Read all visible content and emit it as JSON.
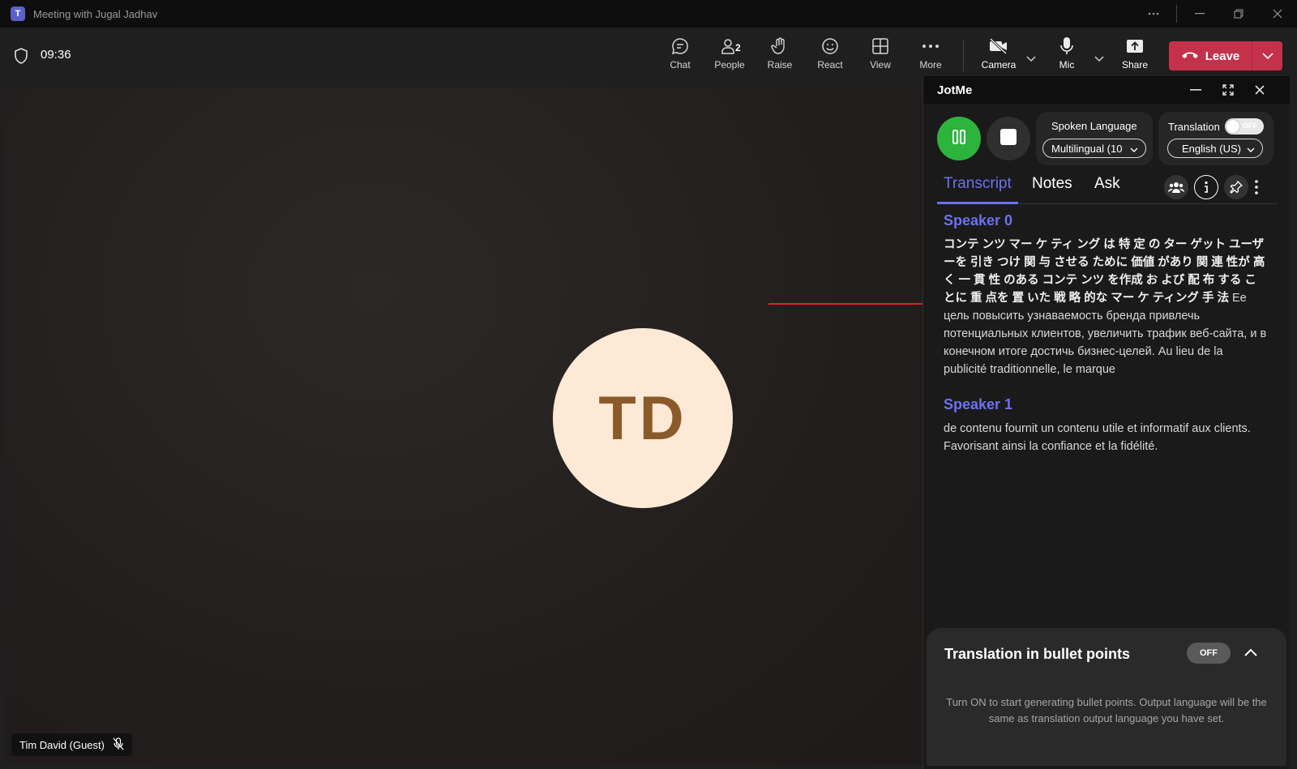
{
  "window": {
    "title": "Meeting with Jugal Jadhav",
    "app_logo": "T"
  },
  "meeting": {
    "elapsed": "09:36",
    "people_count": "2"
  },
  "toolbar": {
    "chat": "Chat",
    "people": "People",
    "raise": "Raise",
    "react": "React",
    "view": "View",
    "more": "More",
    "camera": "Camera",
    "mic": "Mic",
    "share": "Share",
    "leave": "Leave"
  },
  "stage": {
    "avatar_initials": "TD",
    "participant_name": "Tim David (Guest)",
    "avatar_bg": "#fde9d6",
    "avatar_fg": "#8a5a2a"
  },
  "jotme": {
    "title": "JotMe",
    "spoken_language_label": "Spoken Language",
    "spoken_language_value": "Multilingual (10",
    "translation_label": "Translation",
    "translation_toggle": "OFF",
    "translation_language": "English (US)",
    "tabs": [
      "Transcript",
      "Notes",
      "Ask"
    ],
    "transcript": [
      {
        "speaker": "Speaker 0",
        "text_jp": "コンテ ンツ マー ケ ティ ング は 特 定 の ター ゲット ユーザ ーを 引き つけ 関 与 させる ために 価値 があり 関 連 性が 高く 一 貫 性 のある コンテ ンツ を作成 お よび 配 布 する ことに 重 点を 置 いた 戦 略 的な マー ケ ティング 手 法",
        "text_rest": " Ее цель повысить узнаваемость бренда привлечь потенциальных клиентов, увеличить трафик веб-сайта, и в конечном итоге достичь бизнес-целей. Au lieu de la publicité traditionnelle, le marque"
      },
      {
        "speaker": "Speaker 1",
        "text_jp": "",
        "text_rest": "de contenu fournit un contenu utile et informatif aux clients. Favorisant ainsi la confiance et la fidélité."
      }
    ],
    "bullet_points": {
      "title": "Translation in bullet points",
      "toggle": "OFF",
      "description": "Turn ON to start generating bullet points. Output language will be the same as translation output language you have set."
    },
    "accent": "#6b71f2",
    "record_color": "#2db43d"
  },
  "colors": {
    "leave": "#c4314b",
    "annotation_arrow": "#d92626"
  }
}
